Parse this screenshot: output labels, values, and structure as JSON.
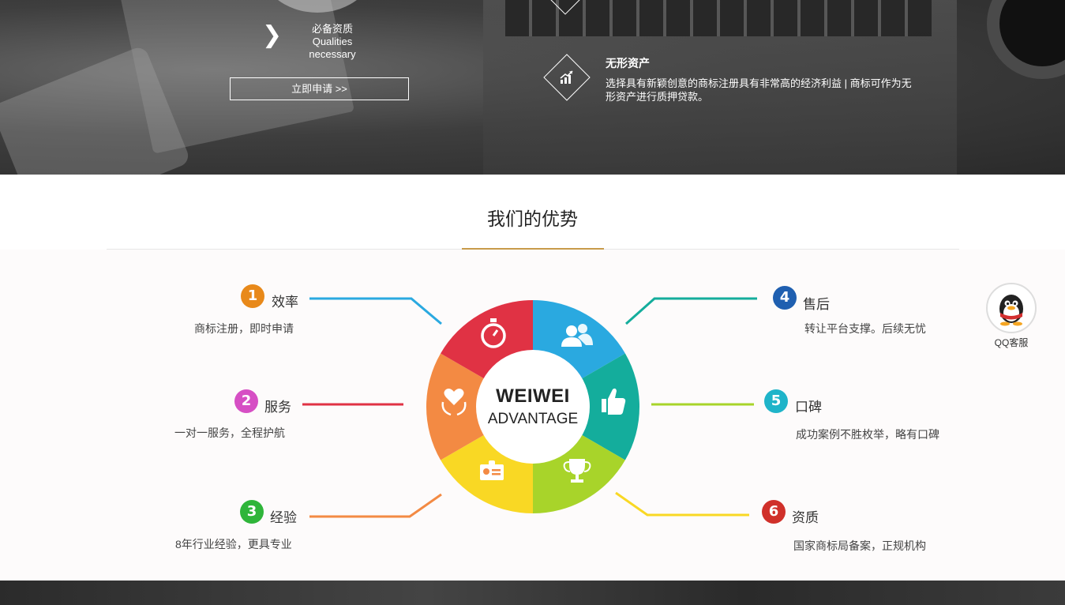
{
  "hero": {
    "qualities_cn": "必备资质",
    "qualities_en1": "Qualities",
    "qualities_en2": "necessary",
    "apply_label": "立即申请 >>",
    "asset_title": "无形资产",
    "asset_desc": "选择具有新颖创意的商标注册具有非常高的经济利益 | 商标可作为无形资产进行质押贷款。"
  },
  "advantage": {
    "title": "我们的优势",
    "wheel_line1": "WEIWEI",
    "wheel_line2": "ADVANTAGE",
    "items": [
      {
        "num": "1",
        "title": "效率",
        "desc": "商标注册，即时申请",
        "color": "#e8891a"
      },
      {
        "num": "2",
        "title": "服务",
        "desc": "一对一服务，全程护航",
        "color": "#d64fc4"
      },
      {
        "num": "3",
        "title": "经验",
        "desc": "8年行业经验，更具专业",
        "color": "#2fb53a"
      },
      {
        "num": "4",
        "title": "售后",
        "desc": "转让平台支撑。后续无忧",
        "color": "#1f5fb0"
      },
      {
        "num": "5",
        "title": "口碑",
        "desc": "成功案例不胜枚举，略有口碑",
        "color": "#1fb4c9"
      },
      {
        "num": "6",
        "title": "资质",
        "desc": "国家商标局备案，正规机构",
        "color": "#d0302a"
      }
    ],
    "segment_colors": [
      "#2aa9e0",
      "#14ad9c",
      "#a8d42a",
      "#f9d824",
      "#f38a43",
      "#e03244"
    ]
  },
  "qq": {
    "label": "QQ客服"
  }
}
